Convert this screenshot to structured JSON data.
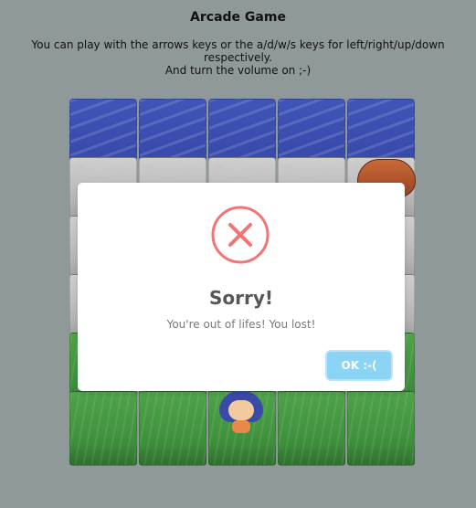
{
  "page": {
    "title": "Arcade Game",
    "instructions_line1": "You can play with the arrows keys or the a/d/w/s keys for left/right/up/down respectively.",
    "instructions_line2": "And turn the volume on ;-)"
  },
  "game": {
    "columns": 5,
    "rows": [
      "water",
      "stone",
      "stone",
      "stone",
      "grass",
      "grass"
    ],
    "enemy": {
      "name": "enemy-bug",
      "row": 1,
      "col": 4
    },
    "player": {
      "name": "player-character",
      "row": 5,
      "col": 2
    }
  },
  "dialog": {
    "icon": "error-icon",
    "title": "Sorry!",
    "message": "You're out of lifes! You lost!",
    "confirm_label": "OK :-("
  },
  "colors": {
    "water": "#3d50b0",
    "stone": "#c3c3c3",
    "grass": "#46993f",
    "error_red": "#f27474",
    "confirm_button": "#8cd4f5"
  }
}
